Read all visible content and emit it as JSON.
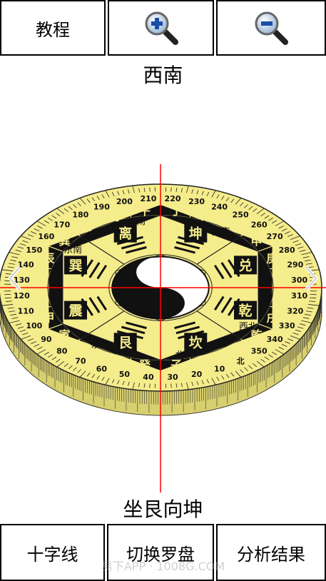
{
  "toolbar_top": {
    "tutorial_label": "教程",
    "zoom_in_icon": "magnifier-plus-icon",
    "zoom_out_icon": "magnifier-minus-icon"
  },
  "direction": {
    "facing": "西南",
    "sitting_facing": "坐艮向坤"
  },
  "compass": {
    "outer_degrees": [
      "190",
      "200",
      "210",
      "220",
      "230",
      "240",
      "250",
      "260",
      "270",
      "280",
      "290",
      "300",
      "310",
      "320",
      "330",
      "340",
      "350",
      "北",
      "10",
      "20",
      "30",
      "40",
      "50",
      "60",
      "70",
      "80",
      "90",
      "100",
      "110",
      "120",
      "130",
      "140",
      "150",
      "160",
      "170",
      "180"
    ],
    "mountains": [
      "午",
      "丁",
      "未",
      "坤",
      "申",
      "庚",
      "酉",
      "辛",
      "戌",
      "乾",
      "亥",
      "壬",
      "子",
      "癸",
      "丑",
      "艮",
      "寅",
      "甲",
      "卯",
      "乙",
      "辰",
      "巽",
      "巳",
      "丙"
    ],
    "trigram_names": [
      "离",
      "坤",
      "兑",
      "乾",
      "坎",
      "艮",
      "震",
      "巽"
    ],
    "direction_words": [
      "南",
      "西南",
      "西",
      "西北",
      "北",
      "东北",
      "东",
      "东南"
    ],
    "colors": {
      "face": "#f5ec8c",
      "ring_dark": "#111111",
      "side": "#d8cf6e",
      "crosshair": "#ff0000"
    }
  },
  "toolbar_bottom": {
    "crosshair_label": "十字线",
    "switch_label": "切换罗盘",
    "result_label": "分析结果"
  },
  "watermark": "易下APP · 1008G.COM"
}
